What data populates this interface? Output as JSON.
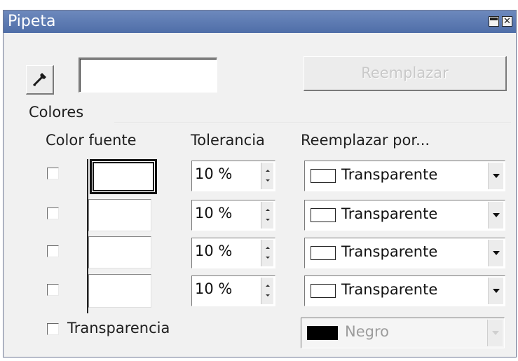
{
  "window": {
    "title": "Pipeta",
    "close_glyph": "✕"
  },
  "top": {
    "pipette_icon": "eyedropper-icon",
    "replace_button": "Reemplazar"
  },
  "colores": {
    "section_label": "Colores",
    "col_source": "Color fuente",
    "col_tolerance": "Tolerancia",
    "col_replace": "Reemplazar por...",
    "rows": [
      {
        "checked": false,
        "tolerance": "10 %",
        "replace_with": "Transparente",
        "replace_color": "#ffffff"
      },
      {
        "checked": false,
        "tolerance": "10 %",
        "replace_with": "Transparente",
        "replace_color": "#ffffff"
      },
      {
        "checked": false,
        "tolerance": "10 %",
        "replace_with": "Transparente",
        "replace_color": "#ffffff"
      },
      {
        "checked": false,
        "tolerance": "10 %",
        "replace_with": "Transparente",
        "replace_color": "#ffffff"
      }
    ]
  },
  "transparency": {
    "label": "Transparencia",
    "checked": false,
    "color_name": "Negro",
    "color": "#000000"
  },
  "colors": {
    "titlebar": "#5a78b0",
    "window_bg": "#f1f1f1",
    "disabled_text": "#c9c9c9"
  }
}
